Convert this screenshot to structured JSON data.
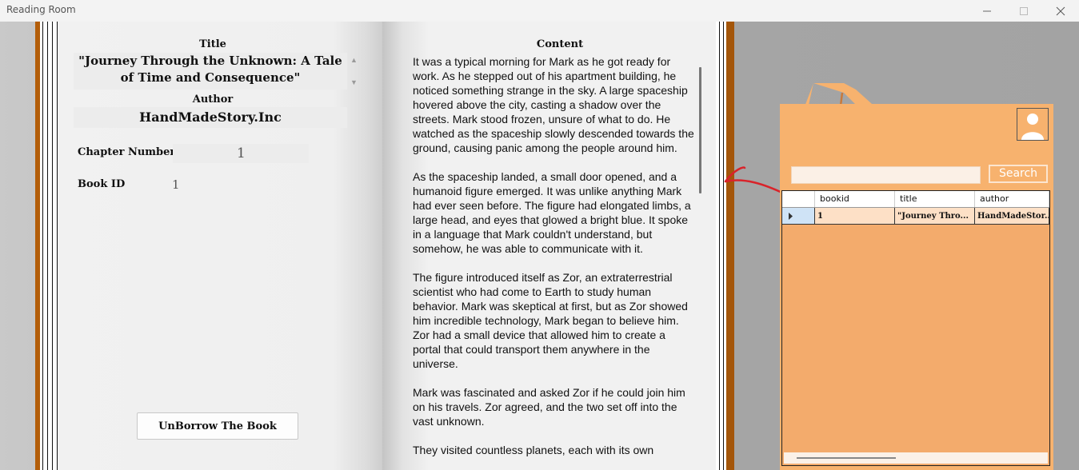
{
  "window": {
    "title": "Reading Room"
  },
  "book": {
    "title_label": "Title",
    "title_value": "\"Journey Through the Unknown: A Tale of Time and Consequence\"",
    "author_label": "Author",
    "author_value": "HandMadeStory.Inc",
    "chapter_label": "Chapter Number",
    "chapter_value": "1",
    "bookid_label": "Book ID",
    "bookid_value": "1",
    "unborrow_label": "UnBorrow The Book",
    "content_label": "Content",
    "content_paragraphs": [
      "It was a typical morning for Mark as he got ready for work. As he stepped out of his apartment building, he noticed something strange in the sky. A large spaceship hovered above the city, casting a shadow over the streets. Mark stood frozen, unsure of what to do. He watched as the spaceship slowly descended towards the ground, causing panic among the people around him.",
      "As the spaceship landed, a small door opened, and a humanoid figure emerged. It was unlike anything Mark had ever seen before. The figure had elongated limbs, a large head, and eyes that glowed a bright blue. It spoke in a language that Mark couldn't understand, but somehow, he was able to communicate with it.",
      "The figure introduced itself as Zor, an extraterrestrial scientist who had come to Earth to study human behavior. Mark was skeptical at first, but as Zor showed him incredible technology, Mark began to believe him. Zor had a small device that allowed him to create a portal that could transport them anywhere in the universe.",
      "Mark was fascinated and asked Zor if he could join him on his travels. Zor agreed, and the two set off into the vast unknown.",
      "They visited countless planets, each with its own"
    ]
  },
  "panel": {
    "search_button": "Search",
    "search_value": "",
    "columns": [
      "bookid",
      "title",
      "author"
    ],
    "rows": [
      {
        "bookid": "1",
        "title": "\"Journey Thro...",
        "author": "HandMadeStor..."
      }
    ]
  },
  "colors": {
    "cover": "#b35e0a",
    "panel": "#f7b26e",
    "annotation": "#d9232a"
  }
}
